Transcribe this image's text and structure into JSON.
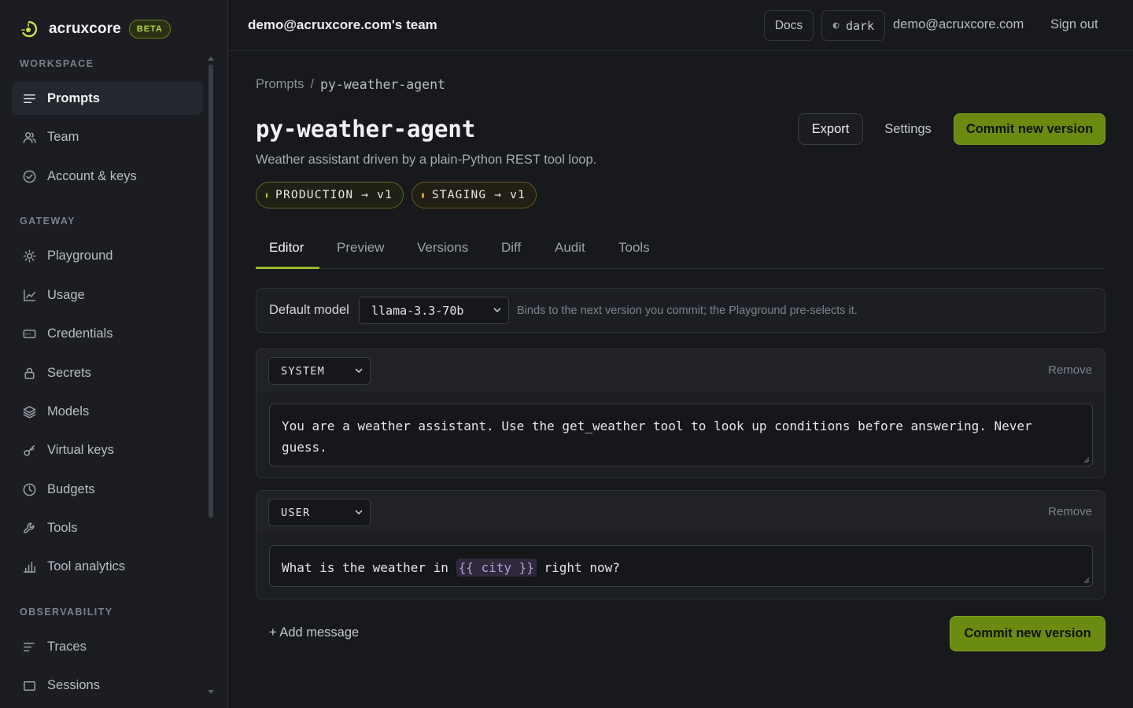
{
  "brand": {
    "name": "acruxcore",
    "badge": "BETA"
  },
  "sidebar": {
    "sections": [
      {
        "label": "WORKSPACE"
      },
      {
        "label": "GATEWAY"
      },
      {
        "label": "OBSERVABILITY"
      }
    ],
    "items": [
      {
        "label": "Prompts",
        "icon": "lines-icon",
        "active": true
      },
      {
        "label": "Team",
        "icon": "users-icon"
      },
      {
        "label": "Account & keys",
        "icon": "check-circle-icon"
      },
      {
        "label": "Playground",
        "icon": "sun-icon"
      },
      {
        "label": "Usage",
        "icon": "line-chart-icon"
      },
      {
        "label": "Credentials",
        "icon": "card-icon"
      },
      {
        "label": "Secrets",
        "icon": "lock-icon"
      },
      {
        "label": "Models",
        "icon": "layers-icon"
      },
      {
        "label": "Virtual keys",
        "icon": "key-icon"
      },
      {
        "label": "Budgets",
        "icon": "clock-icon"
      },
      {
        "label": "Tools",
        "icon": "wrench-icon"
      },
      {
        "label": "Tool analytics",
        "icon": "bar-chart-icon"
      },
      {
        "label": "Traces",
        "icon": "traces-icon"
      },
      {
        "label": "Sessions",
        "icon": "square-icon"
      }
    ]
  },
  "topbar": {
    "team": "demo@acruxcore.com's team",
    "docs": "Docs",
    "theme": "dark",
    "email": "demo@acruxcore.com",
    "signout": "Sign out"
  },
  "breadcrumb": {
    "root": "Prompts",
    "separator": "/",
    "current": "py-weather-agent"
  },
  "prompt": {
    "title": "py-weather-agent",
    "description": "Weather assistant driven by a plain-Python REST tool loop.",
    "export": "Export",
    "settings": "Settings",
    "commit": "Commit new version",
    "envs": [
      {
        "label": "PRODUCTION → v1",
        "color": "#b6d334"
      },
      {
        "label": "STAGING → v1",
        "color": "#e2a52e"
      }
    ]
  },
  "tabs": [
    {
      "label": "Editor",
      "active": true
    },
    {
      "label": "Preview"
    },
    {
      "label": "Versions"
    },
    {
      "label": "Diff"
    },
    {
      "label": "Audit"
    },
    {
      "label": "Tools"
    }
  ],
  "editor": {
    "model_label": "Default model",
    "model_value": "llama-3.3-70b",
    "model_hint": "Binds to the next version you commit; the Playground pre-selects it.",
    "messages": [
      {
        "role": "SYSTEM",
        "remove": "Remove",
        "text": "You are a weather assistant. Use the get_weather tool to look up conditions before answering. Never guess."
      },
      {
        "role": "USER",
        "remove": "Remove",
        "text_before": "What is the weather in ",
        "variable": "{{ city }}",
        "text_after": " right now?"
      }
    ],
    "add_message": "+ Add message",
    "commit": "Commit new version"
  },
  "colors": {
    "accent": "#6b8a10",
    "accent_line": "#9ab82a",
    "background": "#17191d",
    "sidebar": "#1b1d22"
  }
}
